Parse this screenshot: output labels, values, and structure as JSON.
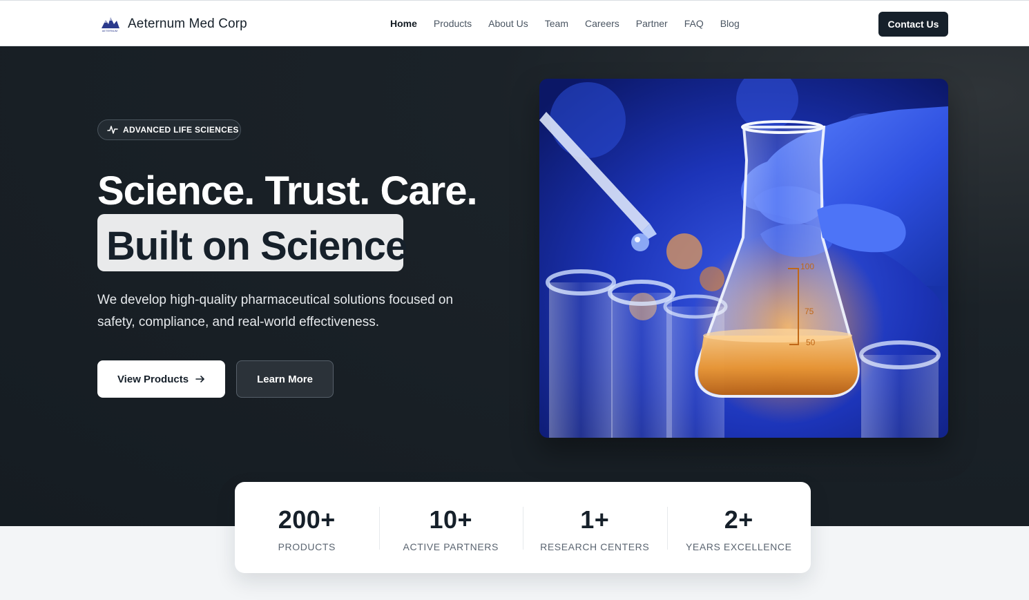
{
  "nav": {
    "brand": "Aeternum Med Corp",
    "logo_text": "AETERNUM",
    "links": [
      "Home",
      "Products",
      "About Us",
      "Team",
      "Careers",
      "Partner",
      "FAQ",
      "Blog"
    ],
    "active": "Home",
    "contact": "Contact Us"
  },
  "hero": {
    "badge": "ADVANCED LIFE SCIENCES",
    "badge_icon": "activity-pulse-icon",
    "headline": "Science. Trust. Care.",
    "highlight": "Built on Science",
    "lead": "We develop high-quality pharmaceutical solutions focused on safety, compliance, and real-world effectiveness.",
    "primary_cta": "View Products",
    "primary_cta_icon": "arrow-right-icon",
    "secondary_cta": "Learn More",
    "image_alt": "laboratory-flask-photo",
    "flask_marks": [
      "100",
      "75",
      "50"
    ]
  },
  "stats": [
    {
      "value": "200+",
      "label": "PRODUCTS"
    },
    {
      "value": "10+",
      "label": "ACTIVE PARTNERS"
    },
    {
      "value": "1+",
      "label": "RESEARCH CENTERS"
    },
    {
      "value": "2+",
      "label": "YEARS EXCELLENCE"
    }
  ],
  "colors": {
    "dark": "#16202a",
    "hero_bg": "#151c22",
    "lab_blue": "#1f3fc4",
    "liquid_amber": "#e9942f"
  }
}
